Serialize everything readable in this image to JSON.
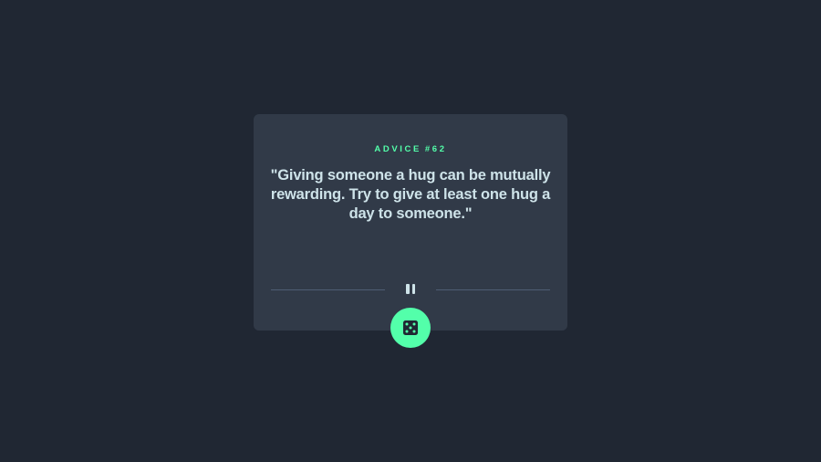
{
  "card": {
    "label_prefix": "ADVICE",
    "advice_number": "#62",
    "quote": "\"Giving someone a hug can be mutually rewarding. Try to give at least one hug a day to someone.\""
  },
  "icons": {
    "divider": "pause-icon",
    "button": "dice-icon"
  },
  "colors": {
    "background": "#202733",
    "card": "#313a48",
    "accent": "#53ffaa",
    "text": "#cee3e9",
    "divider": "#4f5d74"
  }
}
